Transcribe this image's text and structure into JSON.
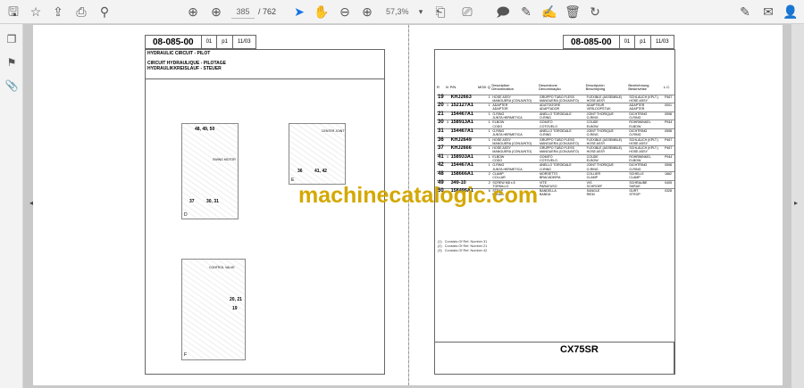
{
  "toolbar": {
    "page_current": "385",
    "page_total": "/ 762",
    "zoom": "57,3%"
  },
  "left_page": {
    "code": "08-085-00",
    "rev": "01",
    "page": "p1",
    "date": "11/03",
    "titles": [
      "HYDRAULIC CIRCUIT - PILOT",
      "CIRCUIT HYDRAULIQUE - PILOTAGE",
      "HYDRAULIKKREISLAUF - STEUER"
    ],
    "figD": {
      "letter": "D",
      "labels": [
        "48, 49, 50",
        "SWING MOTOR",
        "37",
        "30, 31"
      ]
    },
    "figE": {
      "letter": "E",
      "labels": [
        "CENTER JOINT",
        "36",
        "41, 42"
      ]
    },
    "figF": {
      "letter": "F",
      "labels": [
        "CONTROL VALVE",
        "20, 21",
        "19"
      ]
    }
  },
  "right_page": {
    "code": "08-085-00",
    "rev": "01",
    "page": "p1",
    "date": "11/03",
    "headers": [
      "R",
      "N",
      "P/N",
      "MOD",
      "Q",
      "Description\nDénomination",
      "Descrizione\nDenominação",
      "Descripción\nBeschrijving",
      "Bezeichnung\nBeskrivelse",
      "L.C."
    ],
    "rows": [
      {
        "r": "19",
        "n": "",
        "pn": "KHJ2663",
        "mod": "",
        "q": "1",
        "d1": "HOSE ASSY\nMANGUERA (CONJUNTO)",
        "d2": "GRUPPO TUBO FLESS\nMANGUERA (CONJUNTO)",
        "d3": "FLEXIBLE (ASSEMBLE)\nHOSE ASSY",
        "d4": "SCHLAUCH (KPLT.)\nHOSE ASSY",
        "lc": "P467"
      },
      {
        "r": "20",
        "n": "1",
        "pn": "152127A1",
        "mod": "",
        "q": "1",
        "d1": "ADAPTER\nADAPTOR",
        "d2": "ADATTATORE\nADAPTADOR",
        "d3": "ADAPTEUR\nVERLOOPSTUK",
        "d4": "ADAPTER\nADAPTER",
        "lc": "0001"
      },
      {
        "r": "21",
        "n": "",
        "pn": "154467A1",
        "mod": "",
        "q": "1",
        "d1": "O-RING\nJUNTA HERMETICA",
        "d2": "ANELLO TOROIDALE\nO-RING",
        "d3": "JOINT THORIQUE\nO-RING",
        "d4": "DICHTRING\nO-RING",
        "lc": "0598"
      },
      {
        "r": "30",
        "n": "3",
        "pn": "158913A1",
        "mod": "",
        "q": "1",
        "d1": "ELBOW\nCODO",
        "d2": "GOMITO\nCOTOVELO",
        "d3": "COUDE\nELBOW",
        "d4": "ROHRWINKEL\nELBOW",
        "lc": "P944"
      },
      {
        "r": "31",
        "n": "",
        "pn": "154467A1",
        "mod": "",
        "q": "1",
        "d1": "O-RING\nJUNTA HERMETICA",
        "d2": "ANELLO TOROIDALE\nO-RING",
        "d3": "JOINT THORIQUE\nO-RING",
        "d4": "DICHTRING\nO-RING",
        "lc": "0598"
      },
      {
        "r": "36",
        "n": "",
        "pn": "KHJ2649",
        "mod": "",
        "q": "1",
        "d1": "HOSE ASSY\nMANGUERA (CONJUNTO)",
        "d2": "GRUPPO TUBO FLESS\nMANGUERA (CONJUNTO)",
        "d3": "FLEXIBLE (ASSEMBLE)\nHOSE ASSY",
        "d4": "SCHLAUCH (KPLT.)\nHOSE ASSY",
        "lc": "P467"
      },
      {
        "r": "37",
        "n": "",
        "pn": "KHJ2666",
        "mod": "",
        "q": "1",
        "d1": "HOSE ASSY\nMANGUERA (CONJUNTO)",
        "d2": "GRUPPO TUBO FLESS\nMANGUERA (CONJUNTO)",
        "d3": "FLEXIBLE (ASSEMBLE)\nHOSE ASSY",
        "d4": "SCHLAUCH (KPLT.)\nHOSE ASSY",
        "lc": "P467"
      },
      {
        "r": "41",
        "n": "1",
        "pn": "158933A1",
        "mod": "",
        "q": "1",
        "d1": "ELBOW\nCODO",
        "d2": "GOMITO\nCOTOVELO",
        "d3": "COUDE\nELBOW",
        "d4": "ROHRWINKEL\nELBOW",
        "lc": "P944"
      },
      {
        "r": "42",
        "n": "",
        "pn": "154467A1",
        "mod": "",
        "q": "1",
        "d1": "O-RING\nJUNTA HERMETICA",
        "d2": "ANELLO TOROIDALE\nO-RING",
        "d3": "JOINT THORIQUE\nO-RING",
        "d4": "DICHTRING\nO-RING",
        "lc": "0598"
      },
      {
        "r": "48",
        "n": "",
        "pn": "158666A1",
        "mod": "",
        "q": "2",
        "d1": "CLAMP\nCOLLAR",
        "d2": "MORSETTO\nBRACADEIRA",
        "d3": "COLLIER\nCLAMP",
        "d4": "SCHELLE\nCLAMP",
        "lc": "1662"
      },
      {
        "r": "49",
        "n": "",
        "pn": "349-10",
        "mod": "",
        "q": "2",
        "d1": "SCREW M8 x 8\nTORNILLO",
        "d2": "VITE\nPARAFUSO",
        "d3": "VIS\nSCHROEF",
        "d4": "SCHRAUBE\nSKRUE",
        "lc": "0405"
      },
      {
        "r": "50",
        "n": "",
        "pn": "158496A1",
        "mod": "",
        "q": "6",
        "d1": "STRAP\nBANDA",
        "d2": "BANDELLA\nBANDA",
        "d3": "SANGLE\nRIEM",
        "d4": "GURT\nSTROP",
        "lc": "0328"
      }
    ],
    "notes": [
      "(1)   Consists Of Ref. Number 31",
      "(2)   Consists Of Ref. Number 21",
      "(3)   Consists Of Ref. Number 42"
    ],
    "model": "CX75SR"
  },
  "watermark": "machinecatalogic.com"
}
